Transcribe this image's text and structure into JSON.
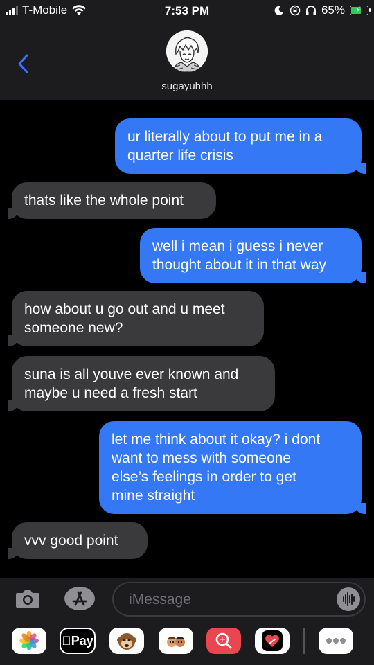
{
  "status_bar": {
    "carrier": "T-Mobile",
    "time": "7:53 PM",
    "battery_percent": "65%",
    "battery_level": 0.65,
    "battery_color": "#34c759"
  },
  "header": {
    "contact_name": "sugayuhhh",
    "back_icon": "chevron-left-icon"
  },
  "messages": [
    {
      "direction": "outgoing",
      "text": "ur literally about to put me in a\nquarter life crisis"
    },
    {
      "direction": "incoming",
      "text": "thats like the whole point"
    },
    {
      "direction": "outgoing",
      "text": "well i mean i guess i never\nthought about it in that way"
    },
    {
      "direction": "incoming",
      "text": "how about u go out and u meet\nsomeone new?"
    },
    {
      "direction": "incoming",
      "text": "suna is all youve ever known and\nmaybe u need a fresh start"
    },
    {
      "direction": "outgoing",
      "text": "let me think about it okay? i dont\nwant to mess with someone\nelse’s feelings in order to get\nmine straight"
    },
    {
      "direction": "incoming",
      "text": "vvv good point"
    }
  ],
  "compose": {
    "placeholder": "iMessage",
    "camera_icon": "camera-icon",
    "app_store_icon": "app-store-icon",
    "audio_icon": "audio-waveform-icon"
  },
  "app_drawer": {
    "apple_pay_label": "Pay",
    "apps": [
      "photos-icon",
      "apple-pay-icon",
      "animoji-icon",
      "memoji-icon",
      "search-images-icon",
      "digital-touch-icon",
      "more-apps-icon"
    ]
  },
  "colors": {
    "outgoing_bubble": "#3478f6",
    "incoming_bubble": "#3a3a3c",
    "background": "#000000"
  }
}
